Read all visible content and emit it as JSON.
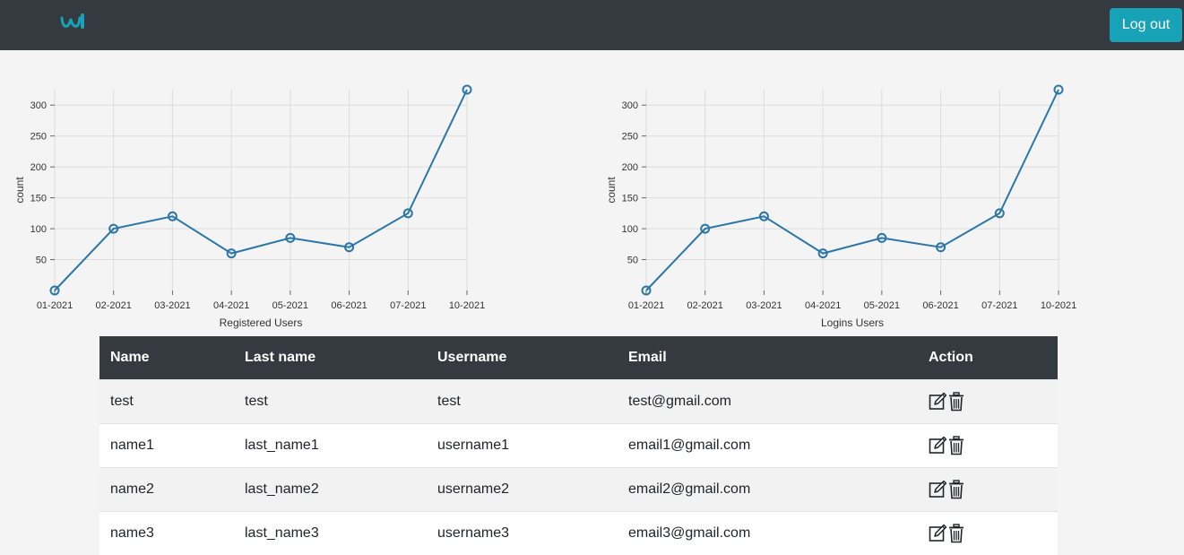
{
  "navbar": {
    "logout_label": "Log out"
  },
  "charts": [
    {
      "id": "registered",
      "xlabel": "Registered Users",
      "ylabel": "count"
    },
    {
      "id": "logins",
      "xlabel": "Logins Users",
      "ylabel": "count"
    }
  ],
  "chart_data": [
    {
      "type": "line",
      "xlabel": "Registered Users",
      "ylabel": "count",
      "categories": [
        "01-2021",
        "02-2021",
        "03-2021",
        "04-2021",
        "05-2021",
        "06-2021",
        "07-2021",
        "10-2021"
      ],
      "values": [
        0,
        100,
        120,
        60,
        85,
        70,
        125,
        325
      ],
      "yticks": [
        50,
        100,
        150,
        200,
        250,
        300
      ],
      "ylim": [
        0,
        325
      ],
      "grid": true,
      "color": "#2b77a8"
    },
    {
      "type": "line",
      "xlabel": "Logins Users",
      "ylabel": "count",
      "categories": [
        "01-2021",
        "02-2021",
        "03-2021",
        "04-2021",
        "05-2021",
        "06-2021",
        "07-2021",
        "10-2021"
      ],
      "values": [
        0,
        100,
        120,
        60,
        85,
        70,
        125,
        325
      ],
      "yticks": [
        50,
        100,
        150,
        200,
        250,
        300
      ],
      "ylim": [
        0,
        325
      ],
      "grid": true,
      "color": "#2b77a8"
    }
  ],
  "table": {
    "headers": [
      "Name",
      "Last name",
      "Username",
      "Email",
      "Action"
    ],
    "rows": [
      {
        "name": "test",
        "last_name": "test",
        "username": "test",
        "email": "test@gmail.com"
      },
      {
        "name": "name1",
        "last_name": "last_name1",
        "username": "username1",
        "email": "email1@gmail.com"
      },
      {
        "name": "name2",
        "last_name": "last_name2",
        "username": "username2",
        "email": "email2@gmail.com"
      },
      {
        "name": "name3",
        "last_name": "last_name3",
        "username": "username3",
        "email": "email3@gmail.com"
      }
    ],
    "action_icons": [
      "edit-icon",
      "trash-icon"
    ]
  },
  "colors": {
    "navbar_bg": "#343a40",
    "accent": "#17a2b8",
    "logo": "#17a2b8",
    "line": "#2b77a8"
  }
}
